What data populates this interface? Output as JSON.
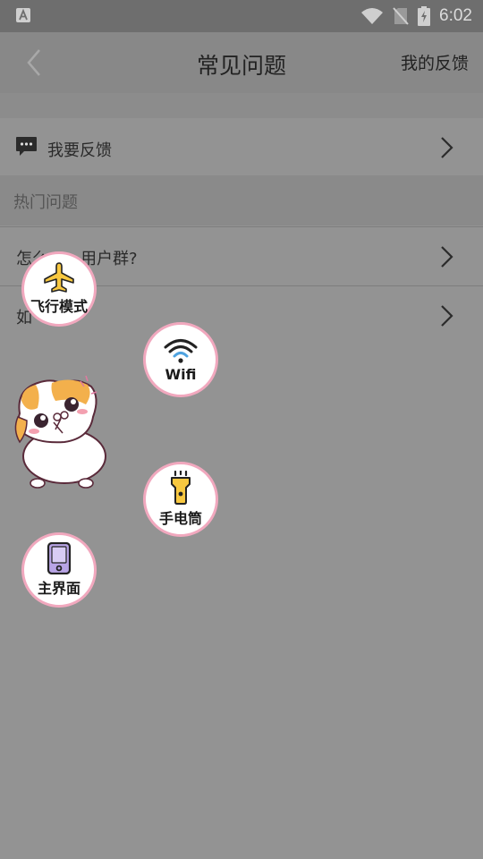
{
  "status_bar": {
    "time": "6:02",
    "left_icon": "a-notification-icon",
    "icons": [
      "wifi-icon",
      "no-sim-icon",
      "battery-charging-icon"
    ]
  },
  "toolbar": {
    "title": "常见问题",
    "right_action": "我的反馈",
    "back_icon": "chevron-left-icon"
  },
  "feedback_row": {
    "label": "我要反馈",
    "icon": "chat-bubble-icon"
  },
  "section": {
    "title": "热门问题"
  },
  "questions": [
    {
      "label": "怎么加入用户群?",
      "visible_text_start": "怎么",
      "visible_text_end": "用户群?"
    },
    {
      "label": "如",
      "visible_text_start": "如"
    }
  ],
  "floating_menu": [
    {
      "label": "飞行模式",
      "icon": "airplane-icon"
    },
    {
      "label": "Wifi",
      "icon": "wifi-icon"
    },
    {
      "label": "手电筒",
      "icon": "flashlight-icon"
    },
    {
      "label": "主界面",
      "icon": "phone-home-icon"
    }
  ],
  "assistive_ball": {
    "icon": "hamster-mascot-icon"
  },
  "colors": {
    "accent_pink": "#f1a8be",
    "airplane_yellow": "#f8c840",
    "phone_purple": "#b8a4e6"
  }
}
